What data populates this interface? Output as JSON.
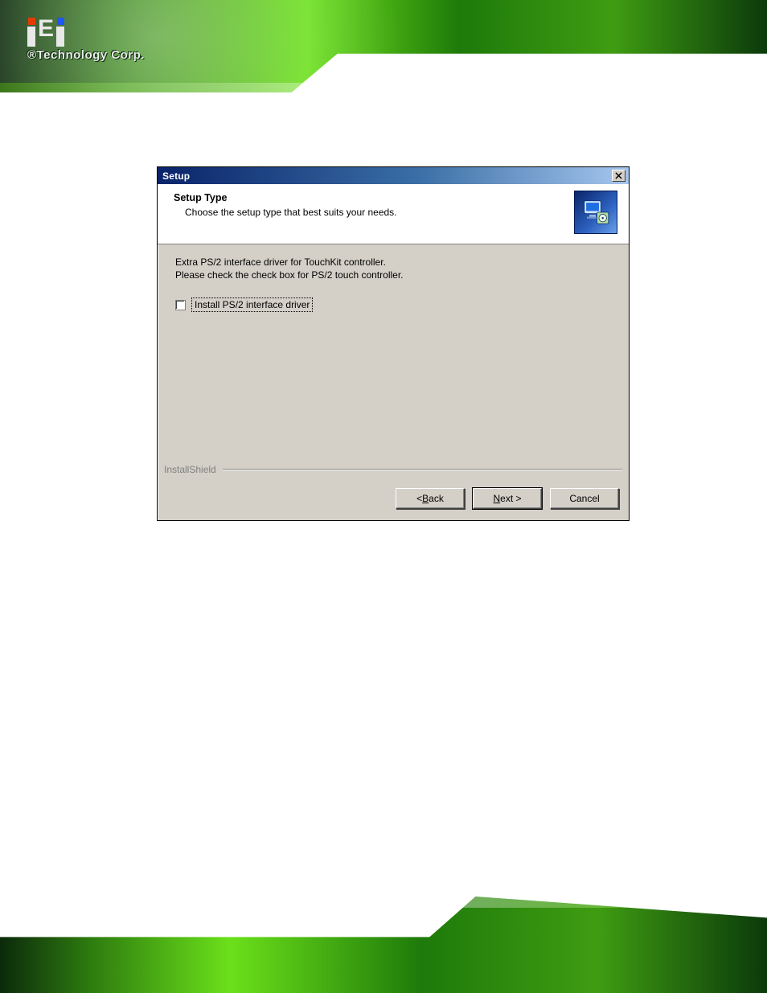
{
  "brand": {
    "tagline": "®Technology Corp."
  },
  "dialog": {
    "title": "Setup",
    "header": {
      "title": "Setup Type",
      "subtitle": "Choose the setup type that best suits your needs."
    },
    "body": {
      "line1": "Extra PS/2 interface driver for TouchKit controller.",
      "line2": "Please check the check box for PS/2 touch controller."
    },
    "checkbox": {
      "label": "Install PS/2 interface driver",
      "checked": false
    },
    "footer_brand": "InstallShield",
    "buttons": {
      "back_prefix": "< ",
      "back_accel": "B",
      "back_rest": "ack",
      "next_accel": "N",
      "next_rest": "ext >",
      "cancel": "Cancel"
    }
  }
}
